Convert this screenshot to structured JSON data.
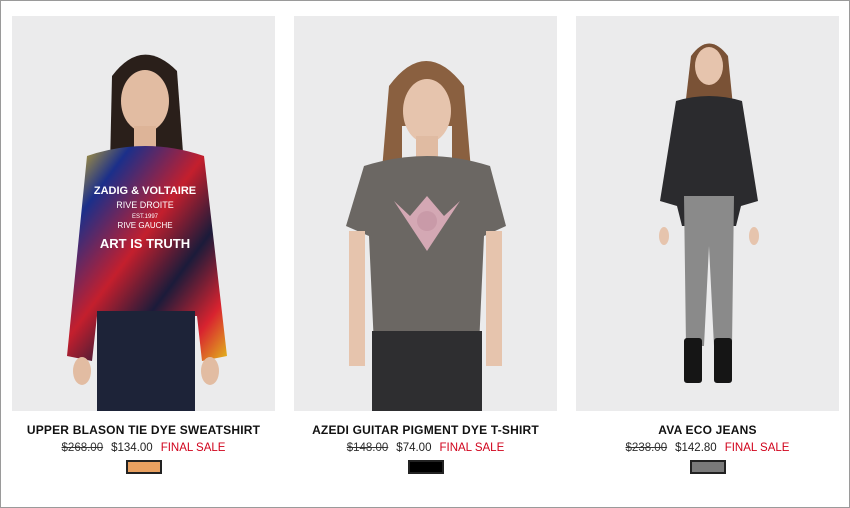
{
  "products": [
    {
      "name": "UPPER BLASON TIE DYE SWEATSHIRT",
      "old_price": "$268.00",
      "new_price": "$134.00",
      "sale_label": "FINAL SALE",
      "swatch_color": "#e8a060",
      "print_lines": [
        "ZADIG & VOLTAIRE",
        "RIVE DROITE",
        "EST.1997",
        "RIVE GAUCHE",
        "ART IS TRUTH"
      ]
    },
    {
      "name": "AZEDI GUITAR PIGMENT DYE T-SHIRT",
      "old_price": "$148.00",
      "new_price": "$74.00",
      "sale_label": "FINAL SALE",
      "swatch_color": "#000000"
    },
    {
      "name": "AVA ECO JEANS",
      "old_price": "$238.00",
      "new_price": "$142.80",
      "sale_label": "FINAL SALE",
      "swatch_color": "#7a7a7a"
    }
  ]
}
